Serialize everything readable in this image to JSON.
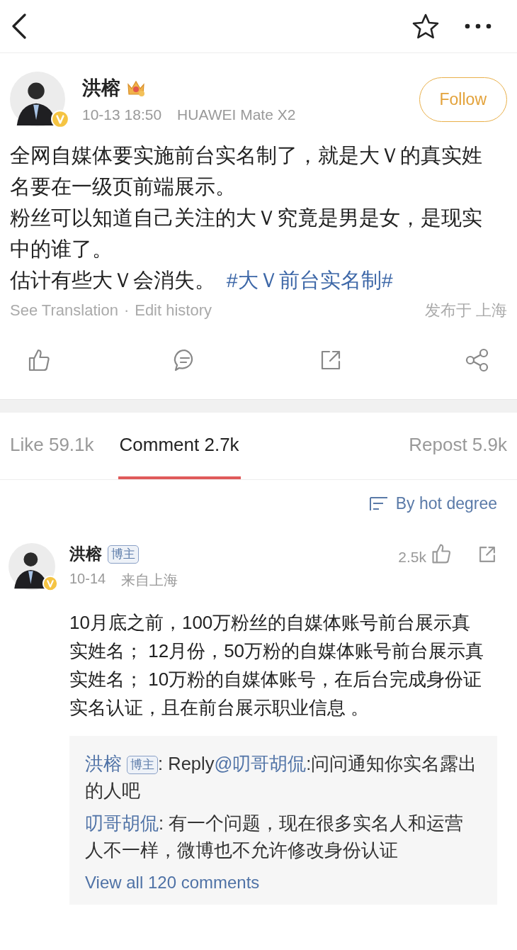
{
  "post": {
    "author": "洪榕",
    "time": "10-13 18:50",
    "device": "HUAWEI Mate X2",
    "follow_label": "Follow",
    "paragraphs": [
      {
        "text": "全网自媒体要实施前台实名制了，就是大Ｖ的真实姓名要在一级页前端展示。"
      },
      {
        "text": "粉丝可以知道自己关注的大Ｖ究竟是男是女，是现实中的谁了。"
      },
      {
        "text": "估计有些大Ｖ会消失。",
        "hashtag": "#大Ｖ前台实名制#"
      }
    ],
    "see_translation": "See Translation",
    "separator": "·",
    "edit_history": "Edit history",
    "location": "发布于 上海"
  },
  "tabs": [
    {
      "label": "Like 59.1k",
      "selected": false
    },
    {
      "label": "Comment 2.7k",
      "selected": true
    },
    {
      "label": "Repost 5.9k",
      "selected": false
    }
  ],
  "sort": {
    "label": "By hot degree"
  },
  "comment": {
    "author": "洪榕",
    "badge": "博主",
    "date": "10-14",
    "location": "来自上海",
    "likes": "2.5k",
    "text": "10月底之前，100万粉丝的自媒体账号前台展示真实姓名； 12月份，50万粉的自媒体账号前台展示真实姓名； 10万粉的自媒体账号，在后台完成身份证实名认证，且在前台展示职业信息 。",
    "replies": [
      {
        "author": "洪榕",
        "badge": "博主",
        "prefix": ": Reply",
        "mention": "@叨哥胡侃",
        "text": ":问问通知你实名露出的人吧"
      },
      {
        "author": "叨哥胡侃",
        "text": ": 有一个问题，现在很多实名人和运营人不一样，微博也不允许修改身份认证"
      }
    ],
    "view_all": "View all 120 comments"
  }
}
